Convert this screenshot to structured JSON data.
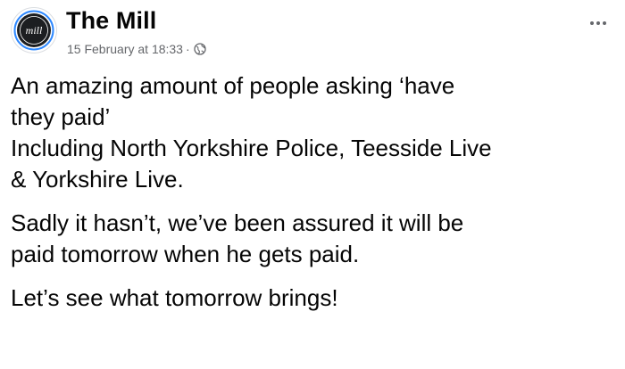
{
  "post": {
    "author": {
      "name": "The Mill",
      "avatar_text": "mill",
      "avatar_icon": "the-mill-logo-icon"
    },
    "timestamp": "15 February at 18:33",
    "separator": "·",
    "privacy_icon": "globe-icon",
    "more_icon": "more-options-icon",
    "paragraphs": [
      {
        "lines": [
          "An amazing amount of people asking ‘have",
          "they paid’",
          "Including North Yorkshire Police, Teesside Live",
          "& Yorkshire Live."
        ]
      },
      {
        "lines": [
          "Sadly it hasn’t, we’ve been assured it will be",
          "paid tomorrow when he gets paid."
        ]
      },
      {
        "lines": [
          "Let’s see what tomorrow brings!"
        ]
      }
    ]
  },
  "colors": {
    "text_primary": "#050505",
    "text_secondary": "#65676b",
    "avatar_bg": "#1c1e21",
    "avatar_ring": "#2d88ff"
  }
}
